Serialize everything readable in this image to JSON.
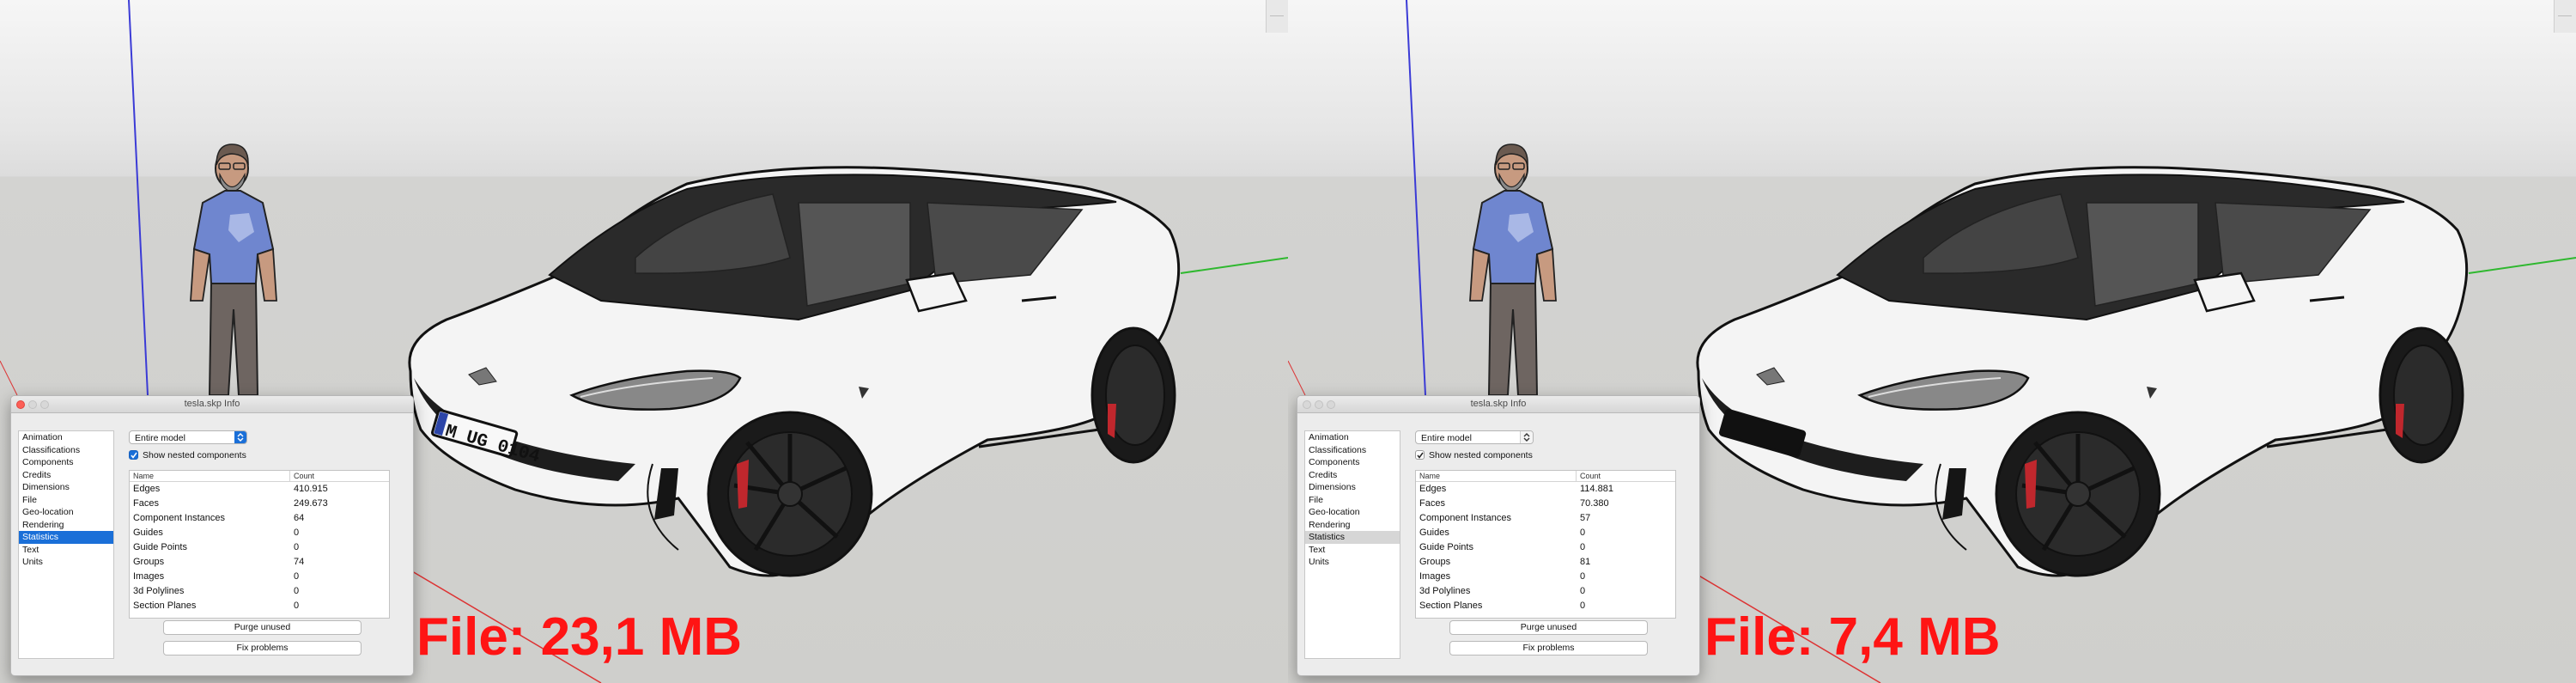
{
  "panels": [
    {
      "id": "original",
      "dialog": {
        "title": "tesla.skp Info",
        "nav_items": [
          "Animation",
          "Classifications",
          "Components",
          "Credits",
          "Dimensions",
          "File",
          "Geo-location",
          "Rendering",
          "Statistics",
          "Text",
          "Units"
        ],
        "selected_nav": "Statistics",
        "scope_select": "Entire model",
        "nested_checkbox_label": "Show nested components",
        "nested_checked": true,
        "table_headers": {
          "name": "Name",
          "count": "Count"
        },
        "rows": [
          {
            "name": "Edges",
            "count": "410.915"
          },
          {
            "name": "Faces",
            "count": "249.673"
          },
          {
            "name": "Component Instances",
            "count": "64"
          },
          {
            "name": "Guides",
            "count": "0"
          },
          {
            "name": "Guide Points",
            "count": "0"
          },
          {
            "name": "Groups",
            "count": "74"
          },
          {
            "name": "Images",
            "count": "0"
          },
          {
            "name": "3d Polylines",
            "count": "0"
          },
          {
            "name": "Section Planes",
            "count": "0"
          }
        ],
        "purge_label": "Purge unused",
        "fix_label": "Fix problems"
      },
      "file_size_label": "File: 23,1 MB",
      "plate_text": "M UG 0104"
    },
    {
      "id": "optimized",
      "dialog": {
        "title": "tesla.skp Info",
        "nav_items": [
          "Animation",
          "Classifications",
          "Components",
          "Credits",
          "Dimensions",
          "File",
          "Geo-location",
          "Rendering",
          "Statistics",
          "Text",
          "Units"
        ],
        "selected_nav": "Statistics",
        "scope_select": "Entire model",
        "nested_checkbox_label": "Show nested components",
        "nested_checked": true,
        "table_headers": {
          "name": "Name",
          "count": "Count"
        },
        "rows": [
          {
            "name": "Edges",
            "count": "114.881"
          },
          {
            "name": "Faces",
            "count": "70.380"
          },
          {
            "name": "Component Instances",
            "count": "57"
          },
          {
            "name": "Guides",
            "count": "0"
          },
          {
            "name": "Guide Points",
            "count": "0"
          },
          {
            "name": "Groups",
            "count": "81"
          },
          {
            "name": "Images",
            "count": "0"
          },
          {
            "name": "3d Polylines",
            "count": "0"
          },
          {
            "name": "Section Planes",
            "count": "0"
          }
        ],
        "purge_label": "Purge unused",
        "fix_label": "Fix problems"
      },
      "file_size_label": "File: 7,4 MB",
      "plate_text": ""
    }
  ],
  "colors": {
    "file_size_red": "#ff1414",
    "selection_blue": "#1a6fd8",
    "car_body": "#f4f4f4",
    "shirt_blue": "#6f86cf"
  },
  "icons": [
    "close-icon",
    "minimize-icon",
    "zoom-icon",
    "chevron-updown-icon",
    "checkmark-icon"
  ]
}
